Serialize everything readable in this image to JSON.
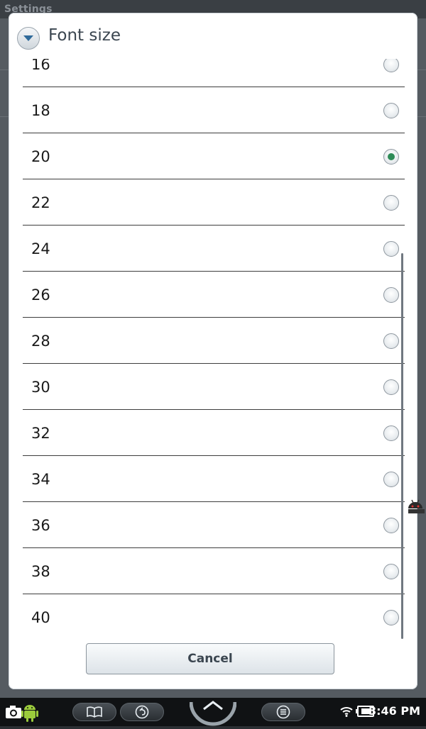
{
  "background": {
    "title": "Settings"
  },
  "dialog": {
    "title": "Font size",
    "options": [
      {
        "label": "16",
        "checked": false
      },
      {
        "label": "18",
        "checked": false
      },
      {
        "label": "20",
        "checked": true
      },
      {
        "label": "22",
        "checked": false
      },
      {
        "label": "24",
        "checked": false
      },
      {
        "label": "26",
        "checked": false
      },
      {
        "label": "28",
        "checked": false
      },
      {
        "label": "30",
        "checked": false
      },
      {
        "label": "32",
        "checked": false
      },
      {
        "label": "34",
        "checked": false
      },
      {
        "label": "36",
        "checked": false
      },
      {
        "label": "38",
        "checked": false
      },
      {
        "label": "40",
        "checked": false
      }
    ],
    "cancel_label": "Cancel",
    "accent_color": "#2e8b57"
  },
  "status_bar": {
    "time": "3:46 PM",
    "icons": [
      "camera-icon",
      "android-icon",
      "book-icon",
      "back-icon",
      "home-icon",
      "menu-icon",
      "wifi-icon",
      "battery-icon"
    ]
  }
}
